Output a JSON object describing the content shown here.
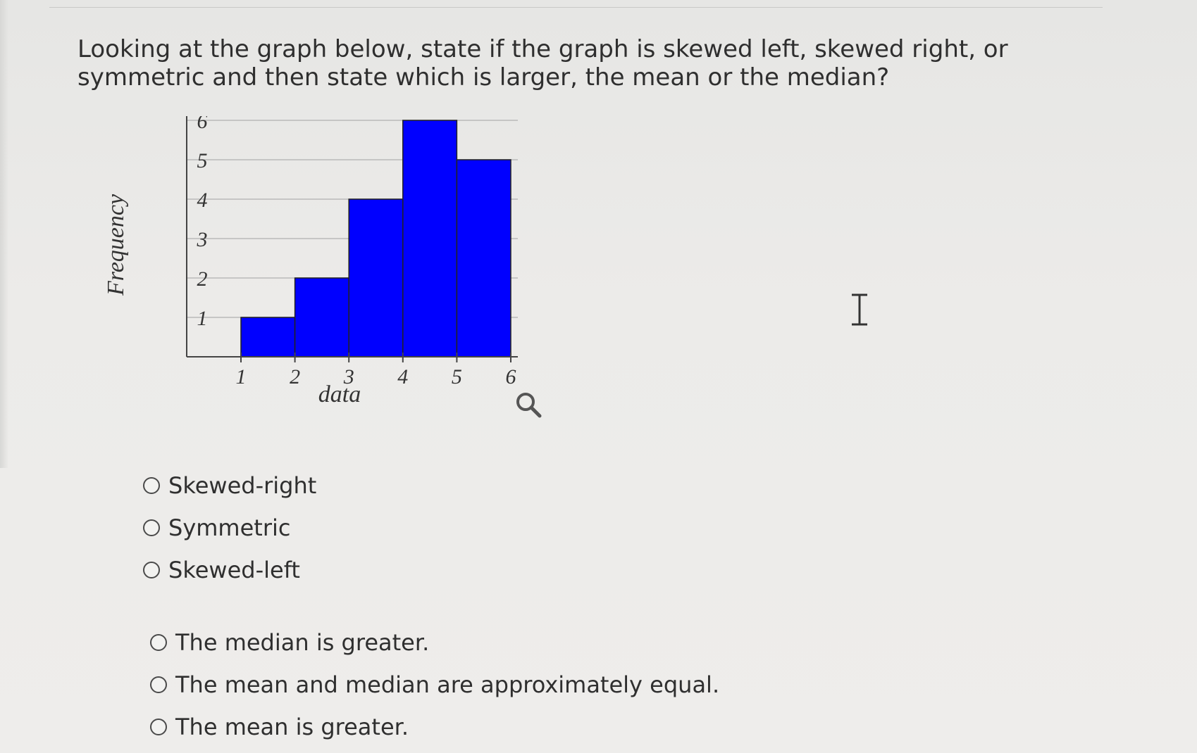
{
  "question": {
    "text": "Looking at the graph below, state if the graph is skewed left, skewed right, or symmetric and then state which is larger, the mean or the median?"
  },
  "chart_data": {
    "type": "bar",
    "categories": [
      "1",
      "2",
      "3",
      "4",
      "5",
      "6"
    ],
    "bins": [
      [
        1,
        2
      ],
      [
        2,
        3
      ],
      [
        3,
        4
      ],
      [
        4,
        5
      ],
      [
        5,
        6
      ]
    ],
    "values": [
      1,
      2,
      4,
      6,
      5
    ],
    "x_ticks": [
      "1",
      "2",
      "3",
      "4",
      "5",
      "6"
    ],
    "y_ticks": [
      "1",
      "2",
      "3",
      "4",
      "5",
      "6"
    ],
    "xlabel": "data",
    "ylabel": "Frequency",
    "ylim": [
      0,
      6.2
    ],
    "grid": true,
    "bar_color": "#0000ff"
  },
  "icons": {
    "zoom": "magnifier-icon",
    "cursor": "text-cursor-icon"
  },
  "skew_options": [
    {
      "label": "Skewed-right"
    },
    {
      "label": "Symmetric"
    },
    {
      "label": "Skewed-left"
    }
  ],
  "center_options": [
    {
      "label": "The median is greater."
    },
    {
      "label": "The mean and median are approximately equal."
    },
    {
      "label": "The mean is greater."
    }
  ]
}
